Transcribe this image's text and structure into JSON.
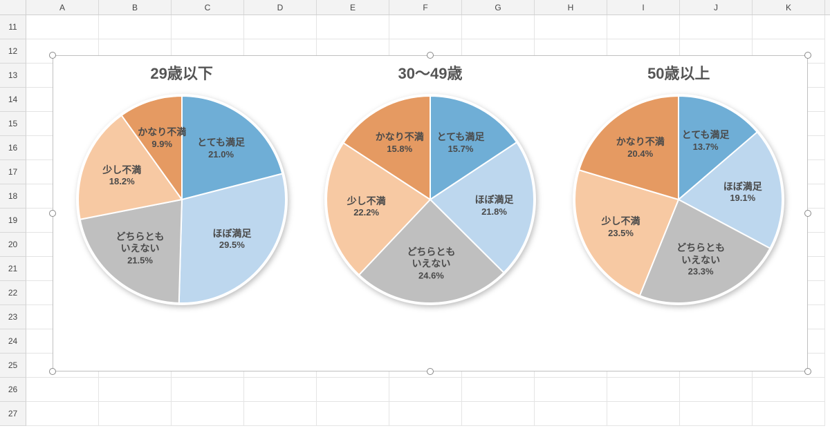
{
  "grid": {
    "columns": [
      "A",
      "B",
      "C",
      "D",
      "E",
      "F",
      "G",
      "H",
      "I",
      "J",
      "K"
    ],
    "first_row": 11,
    "last_row": 27
  },
  "colors": {
    "very_satisfied": "#6faed6",
    "mostly_satisfied": "#bdd7ee",
    "neither": "#bfbfbf",
    "slightly_dissatisfied": "#f7c9a3",
    "very_dissatisfied": "#e59a62",
    "slice_border": "#ffffff"
  },
  "bands": {
    "very_satisfied": "とても満足",
    "mostly_satisfied": "ほぼ満足",
    "neither_line1": "どちらとも",
    "neither_line2": "いえない",
    "slightly_dissatisfied": "少し不満",
    "very_dissatisfied": "かなり不満"
  },
  "chart_data": [
    {
      "type": "pie",
      "title": "29歳以下",
      "series": [
        {
          "name": "とても満足",
          "value": 21.0,
          "color_key": "very_satisfied"
        },
        {
          "name": "ほぼ満足",
          "value": 29.5,
          "color_key": "mostly_satisfied"
        },
        {
          "name": "どちらともいえない",
          "value": 21.5,
          "color_key": "neither"
        },
        {
          "name": "少し不満",
          "value": 18.2,
          "color_key": "slightly_dissatisfied"
        },
        {
          "name": "かなり不満",
          "value": 9.9,
          "color_key": "very_dissatisfied"
        }
      ]
    },
    {
      "type": "pie",
      "title": "30～49歳",
      "series": [
        {
          "name": "とても満足",
          "value": 15.7,
          "color_key": "very_satisfied"
        },
        {
          "name": "ほぼ満足",
          "value": 21.8,
          "color_key": "mostly_satisfied"
        },
        {
          "name": "どちらともいえない",
          "value": 24.6,
          "color_key": "neither"
        },
        {
          "name": "少し不満",
          "value": 22.2,
          "color_key": "slightly_dissatisfied"
        },
        {
          "name": "かなり不満",
          "value": 15.8,
          "color_key": "very_dissatisfied"
        }
      ]
    },
    {
      "type": "pie",
      "title": "50歳以上",
      "series": [
        {
          "name": "とても満足",
          "value": 13.7,
          "color_key": "very_satisfied"
        },
        {
          "name": "ほぼ満足",
          "value": 19.1,
          "color_key": "mostly_satisfied"
        },
        {
          "name": "どちらともいえない",
          "value": 23.3,
          "color_key": "neither"
        },
        {
          "name": "少し不満",
          "value": 23.5,
          "color_key": "slightly_dissatisfied"
        },
        {
          "name": "かなり不満",
          "value": 20.4,
          "color_key": "very_dissatisfied"
        }
      ]
    }
  ]
}
